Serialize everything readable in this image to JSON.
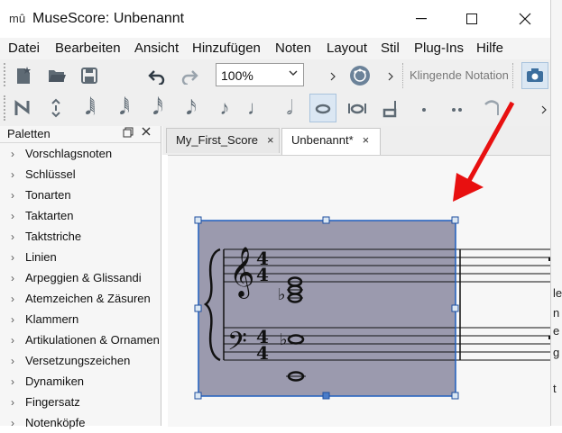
{
  "window": {
    "title": "MuseScore: Unbenannt",
    "app_icon": "mû",
    "controls": [
      "minimize",
      "maximize",
      "close"
    ]
  },
  "menu": {
    "items": [
      "Datei",
      "Bearbeiten",
      "Ansicht",
      "Hinzufügen",
      "Noten",
      "Layout",
      "Stil",
      "Plug-Ins",
      "Hilfe"
    ]
  },
  "toolbar": {
    "zoom": "100%",
    "sound_label": "Klingende Notation",
    "icons": [
      "new-score-icon",
      "open-icon",
      "save-icon",
      "undo-icon",
      "redo-icon",
      "chevron-right-icon",
      "metronome-icon",
      "chevron-right-icon",
      "camera-icon"
    ]
  },
  "note_toolbar": {
    "icons": [
      "note-input-icon",
      "voice-arrows-icon",
      "128th-note-icon",
      "64th-note-icon",
      "32nd-note-icon",
      "16th-note-icon",
      "eighth-note-icon",
      "quarter-note-icon",
      "half-note-icon",
      "whole-note-icon",
      "breve-icon",
      "longa-icon",
      "dot-icon",
      "double-dot-icon",
      "tie-icon",
      "chevron-right-icon"
    ],
    "selected": "whole-note-icon"
  },
  "palettes": {
    "title": "Paletten",
    "items": [
      "Vorschlagsnoten",
      "Schlüssel",
      "Tonarten",
      "Taktarten",
      "Taktstriche",
      "Linien",
      "Arpeggien & Glissandi",
      "Atemzeichen & Zäsuren",
      "Klammern",
      "Artikulationen & Ornamente",
      "Versetzungszeichen",
      "Dynamiken",
      "Fingersatz",
      "Notenköpfe"
    ]
  },
  "score": {
    "tabs": [
      {
        "label": "My_First_Score",
        "close": "×"
      },
      {
        "label": "Unbenannt*",
        "close": "×"
      }
    ],
    "active_tab": "Unbenannt*",
    "time_signature": [
      "4",
      "4"
    ]
  },
  "colors": {
    "selection_fill": "#9b9aae",
    "selection_border": "#1f5fbf",
    "annotation_arrow": "#e81010"
  },
  "outside_text": [
    "le",
    "n",
    "e",
    "g",
    "t"
  ]
}
